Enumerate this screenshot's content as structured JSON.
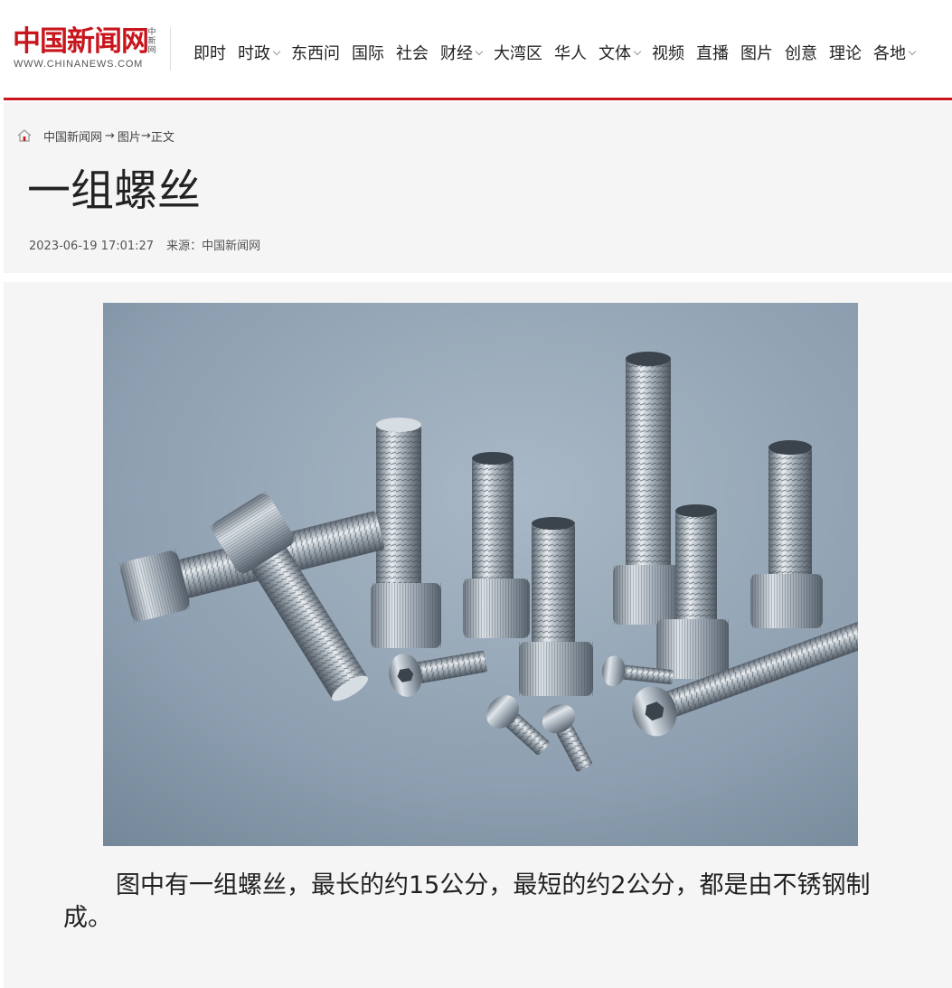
{
  "header": {
    "logo": {
      "name_cn": "中国新闻网",
      "seal_text": "中新网",
      "url_text": "WWW.CHINANEWS.COM"
    },
    "nav": [
      {
        "label": "即时",
        "has_dropdown": false
      },
      {
        "label": "时政",
        "has_dropdown": true
      },
      {
        "label": "东西问",
        "has_dropdown": false
      },
      {
        "label": "国际",
        "has_dropdown": false
      },
      {
        "label": "社会",
        "has_dropdown": false
      },
      {
        "label": "财经",
        "has_dropdown": true
      },
      {
        "label": "大湾区",
        "has_dropdown": false
      },
      {
        "label": "华人",
        "has_dropdown": false
      },
      {
        "label": "文体",
        "has_dropdown": true
      },
      {
        "label": "视频",
        "has_dropdown": false
      },
      {
        "label": "直播",
        "has_dropdown": false
      },
      {
        "label": "图片",
        "has_dropdown": false
      },
      {
        "label": "创意",
        "has_dropdown": false
      },
      {
        "label": "理论",
        "has_dropdown": false
      },
      {
        "label": "各地",
        "has_dropdown": true
      }
    ],
    "accent_color": "#c8161d"
  },
  "breadcrumb": {
    "home_icon": "home-icon",
    "items": [
      "中国新闻网",
      "图片",
      "正文"
    ],
    "separators": [
      " → ",
      "→"
    ]
  },
  "article": {
    "title": "一组螺丝",
    "datetime": "2023-06-19 17:01:27",
    "source_label": "来源：",
    "source": "中国新闻网",
    "image_subject": "stainless steel socket head cap screws on grey-blue background",
    "caption": "图中有一组螺丝，最长的约15公分，最短的约2公分，都是由不锈钢制成。"
  }
}
